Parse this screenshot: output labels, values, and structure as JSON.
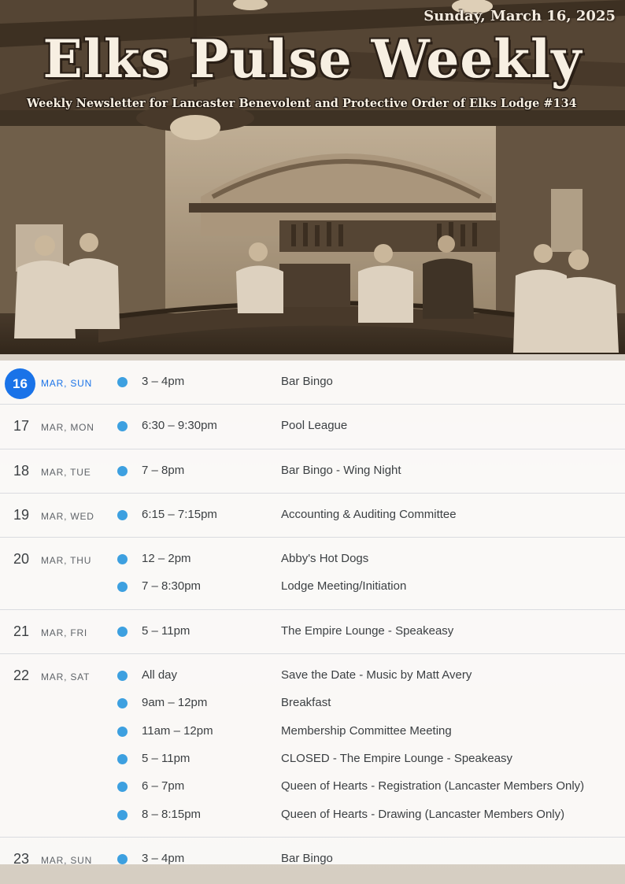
{
  "header": {
    "date": "Sunday, March 16, 2025",
    "title": "Elks Pulse Weekly",
    "subtitle": "Weekly Newsletter for Lancaster Benevolent and Protective Order of Elks Lodge #134"
  },
  "colors": {
    "today_badge": "#1a73e8",
    "event_dot": "#3da0e0",
    "text": "#3c4043",
    "muted": "#5f6368"
  },
  "days": [
    {
      "num": "16",
      "label": "MAR, SUN",
      "today": true,
      "events": [
        {
          "time": "3 – 4pm",
          "title": "Bar Bingo"
        }
      ]
    },
    {
      "num": "17",
      "label": "MAR, MON",
      "events": [
        {
          "time": "6:30 – 9:30pm",
          "title": "Pool League"
        }
      ]
    },
    {
      "num": "18",
      "label": "MAR, TUE",
      "events": [
        {
          "time": "7 – 8pm",
          "title": "Bar Bingo - Wing Night"
        }
      ]
    },
    {
      "num": "19",
      "label": "MAR, WED",
      "events": [
        {
          "time": "6:15 – 7:15pm",
          "title": "Accounting & Auditing Committee"
        }
      ]
    },
    {
      "num": "20",
      "label": "MAR, THU",
      "events": [
        {
          "time": "12 – 2pm",
          "title": "Abby's Hot Dogs"
        },
        {
          "time": "7 – 8:30pm",
          "title": "Lodge Meeting/Initiation"
        }
      ]
    },
    {
      "num": "21",
      "label": "MAR, FRI",
      "events": [
        {
          "time": "5 – 11pm",
          "title": "The Empire Lounge - Speakeasy"
        }
      ]
    },
    {
      "num": "22",
      "label": "MAR, SAT",
      "events": [
        {
          "time": "All day",
          "title": "Save the Date - Music by Matt Avery"
        },
        {
          "time": "9am – 12pm",
          "title": "Breakfast"
        },
        {
          "time": "11am – 12pm",
          "title": "Membership Committee Meeting"
        },
        {
          "time": "5 – 11pm",
          "title": "CLOSED - The Empire Lounge - Speakeasy"
        },
        {
          "time": "6 – 7pm",
          "title": "Queen of Hearts - Registration (Lancaster Members Only)"
        },
        {
          "time": "8 – 8:15pm",
          "title": "Queen of Hearts - Drawing (Lancaster Members Only)"
        }
      ]
    },
    {
      "num": "23",
      "label": "MAR, SUN",
      "events": [
        {
          "time": "3 – 4pm",
          "title": "Bar Bingo"
        }
      ]
    }
  ]
}
